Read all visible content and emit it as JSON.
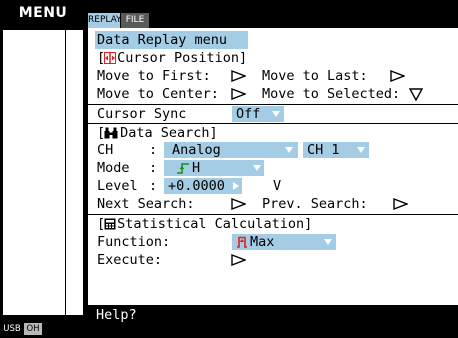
{
  "sidebar": {
    "title": "MENU"
  },
  "status": {
    "usb": "USB",
    "oh": "OH"
  },
  "tabs": [
    {
      "label": "REPLAY",
      "active": true
    },
    {
      "label": "FILE",
      "active": false
    }
  ],
  "content": {
    "title": "Data Replay menu",
    "cursor_section": {
      "header": "Cursor Position]",
      "move_first": "Move to First:",
      "move_last": "Move to Last:",
      "move_center": "Move to Center:",
      "move_selected": "Move to Selected:",
      "icon": "cursor-position-icon"
    },
    "cursor_sync": {
      "label": "Cursor Sync",
      "value": "Off"
    },
    "data_search": {
      "header": "Data Search]",
      "icon": "binoculars-icon",
      "ch_label": "CH",
      "ch_colon": ":",
      "ch_type": "Analog",
      "ch_num": "CH 1",
      "mode_label": "Mode",
      "mode_colon": ":",
      "mode_value": "H",
      "level_label": "Level",
      "level_colon": ":",
      "level_value": "+0.0000",
      "level_unit": "V",
      "next_search": "Next Search:",
      "prev_search": "Prev. Search:"
    },
    "statistical": {
      "header": "Statistical Calculation]",
      "icon": "calculator-icon",
      "function_label": "Function:",
      "function_value": "Max",
      "execute_label": "Execute:"
    }
  },
  "help": {
    "text": "Help?"
  },
  "colors": {
    "accent": "#a4cce4",
    "background": "#000000",
    "panel": "#ffffff",
    "marker": "#e02020"
  }
}
